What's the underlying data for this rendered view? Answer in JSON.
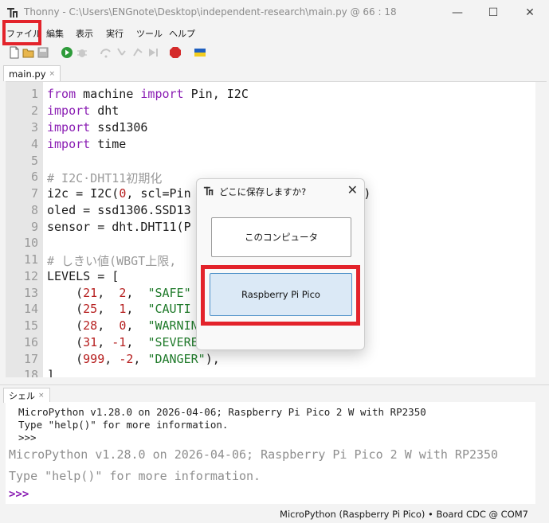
{
  "titlebar": {
    "title": "Thonny  -  C:\\Users\\ENGnote\\Desktop\\independent-research\\main.py  @  66 : 18",
    "minimize_glyph": "—",
    "maximize_glyph": "☐",
    "close_glyph": "✕"
  },
  "menu": {
    "items": [
      "ファイル",
      "編集",
      "表示",
      "実行",
      "ツール",
      "ヘルプ"
    ]
  },
  "toolbar": {
    "icons": [
      "new-file-icon",
      "open-file-icon",
      "save-icon",
      "run-icon",
      "debug-icon",
      "step-over-icon",
      "step-into-icon",
      "step-out-icon",
      "resume-icon",
      "stop-icon",
      "ukraine-flag-icon"
    ],
    "stop_label": "STOP"
  },
  "editor": {
    "tab_label": "main.py",
    "tab_close": "×",
    "line_numbers": [
      "1",
      "2",
      "3",
      "4",
      "5",
      "6",
      "7",
      "8",
      "9",
      "10",
      "11",
      "12",
      "13",
      "14",
      "15",
      "16",
      "17",
      "18"
    ]
  },
  "shell": {
    "tab_label": "シェル",
    "tab_close": "×",
    "line1": "MicroPython v1.28.0 on 2026-04-06; Raspberry Pi Pico 2 W with RP2350",
    "line2": "Type \"help()\" for more information.",
    "line3": ">>>",
    "line4": "MicroPython v1.28.0 on 2026-04-06; Raspberry Pi Pico 2 W with RP2350",
    "line5": "Type \"help()\" for more information.",
    "prompt": ">>>"
  },
  "status": {
    "text": "MicroPython (Raspberry Pi Pico)  •  Board CDC @ COM7"
  },
  "dialog": {
    "title": "どこに保存しますか?",
    "close_glyph": "✕",
    "option_computer": "このコンピュータ",
    "option_pico": "Raspberry Pi Pico"
  },
  "colors": {
    "keyword": "#8a1db3",
    "number": "#b61f1f",
    "string": "#1f7a2a",
    "comment": "#9a9a9a",
    "highlight": "#e3232b"
  }
}
